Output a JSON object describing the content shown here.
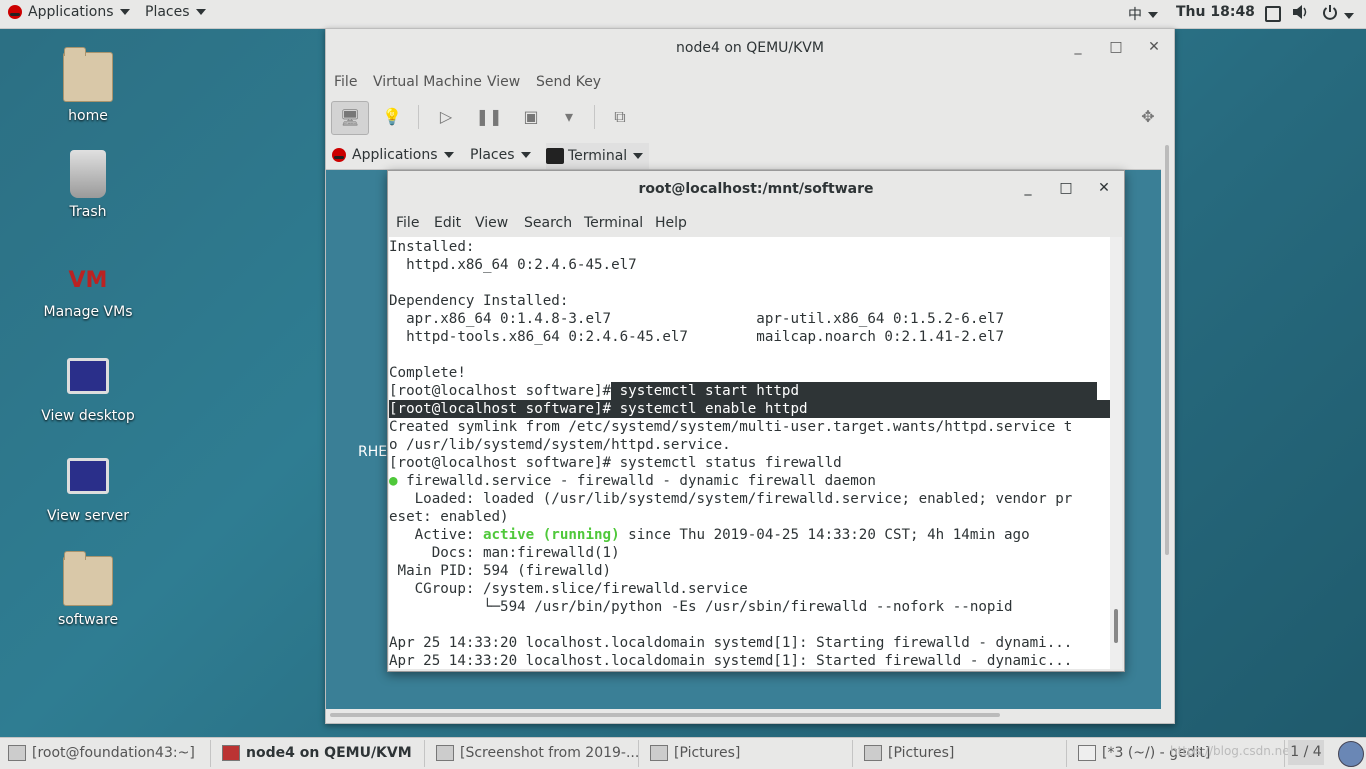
{
  "top_panel": {
    "applications": "Applications",
    "places": "Places",
    "input_method": "中",
    "clock": "Thu 18:48"
  },
  "desktop_icons": [
    {
      "label": "home"
    },
    {
      "label": "Trash"
    },
    {
      "label": "Manage VMs"
    },
    {
      "label": "View desktop"
    },
    {
      "label": "View server"
    },
    {
      "label": "software"
    }
  ],
  "vm_window": {
    "title": "node4 on QEMU/KVM",
    "menu": [
      "File",
      "Virtual Machine",
      "View",
      "Send Key"
    ]
  },
  "guest": {
    "applications": "Applications",
    "places": "Places",
    "terminal": "Terminal",
    "bg_text": "RHE"
  },
  "terminal": {
    "title": "root@localhost:/mnt/software",
    "menu": [
      "File",
      "Edit",
      "View",
      "Search",
      "Terminal",
      "Help"
    ],
    "lines": [
      "Installed:",
      "  httpd.x86_64 0:2.4.6-45.el7",
      "",
      "Dependency Installed:",
      "  apr.x86_64 0:1.4.8-3.el7                 apr-util.x86_64 0:1.5.2-6.el7",
      "  httpd-tools.x86_64 0:2.4.6-45.el7        mailcap.noarch 0:2.1.41-2.el7",
      "",
      "Complete!"
    ],
    "prompt": "[root@localhost software]#",
    "cmd_start": " systemctl start httpd",
    "cmd_enable": " systemctl enable httpd",
    "symlink_1": "Created symlink from /etc/systemd/system/multi-user.target.wants/httpd.service t",
    "symlink_2": "o /usr/lib/systemd/system/httpd.service.",
    "cmd_status": " systemctl status firewalld",
    "status_dot": "●",
    "status_head": " firewalld.service - firewalld - dynamic firewall daemon",
    "loaded_1": "   Loaded: loaded (/usr/lib/systemd/system/firewalld.service; enabled; vendor pr",
    "loaded_2": "eset: enabled)",
    "active_label": "   Active: ",
    "active_state": "active (running)",
    "active_rest": " since Thu 2019-04-25 14:33:20 CST; 4h 14min ago",
    "docs": "     Docs: man:firewalld(1)",
    "mainpid": " Main PID: 594 (firewalld)",
    "cgroup": "   CGroup: /system.slice/firewalld.service",
    "cgroup_child": "           └─594 /usr/bin/python -Es /usr/sbin/firewalld --nofork --nopid",
    "log_1": "Apr 25 14:33:20 localhost.localdomain systemd[1]: Starting firewalld - dynami...",
    "log_2": "Apr 25 14:33:20 localhost.localdomain systemd[1]: Started firewalld - dynamic..."
  },
  "taskbar": {
    "items": [
      "[root@foundation43:~]",
      "node4 on QEMU/KVM",
      "[Screenshot from 2019-...",
      "[Pictures]",
      "[Pictures]",
      "[*3 (~/) - gedit]"
    ],
    "watermark": "https://blog.csdn.net/",
    "pager": "1 / 4"
  },
  "colors": {
    "desktop": "#2c6f83",
    "panel": "#e8e8e7",
    "terminal_bg": "#ffffff",
    "status_green": "#4fc83a",
    "highlight": "#2e3436"
  }
}
